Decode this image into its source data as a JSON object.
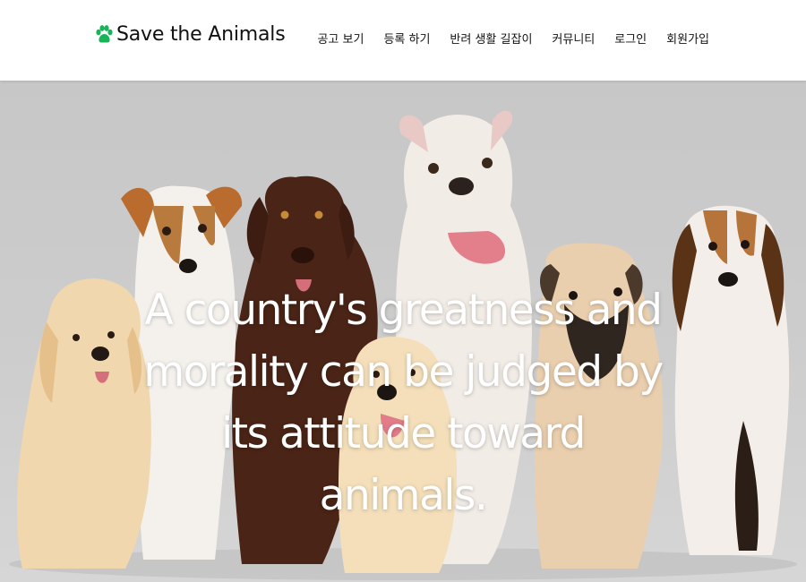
{
  "header": {
    "brand_name": "Save the Animals",
    "brand_icon": "paw-icon",
    "brand_color": "#19b35a",
    "nav": [
      {
        "label": "공고 보기"
      },
      {
        "label": "등록 하기"
      },
      {
        "label": "반려 생활 길잡이"
      },
      {
        "label": "커뮤니티"
      },
      {
        "label": "로그인"
      },
      {
        "label": "회원가입"
      }
    ]
  },
  "hero": {
    "quote": "A country's greatness and morality can be judged by its attitude toward animals.",
    "background_color": "#cccccc"
  }
}
